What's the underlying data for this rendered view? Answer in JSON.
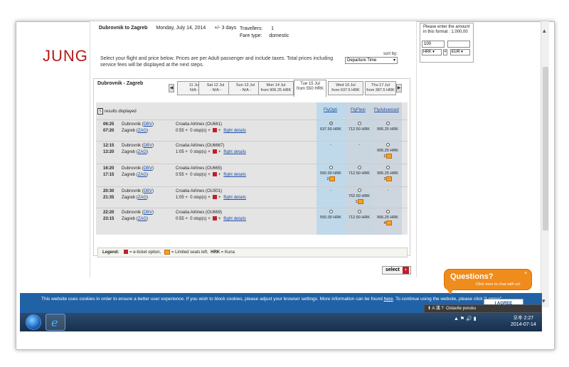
{
  "brand": "JUNG",
  "trip": {
    "route": "Dubrovnik to Zagreb",
    "date": "Monday, July 14, 2014",
    "flex": "+/- 3 days",
    "travellers_label": "Travellers:",
    "travellers_value": "1",
    "fare_label": "Fare type:",
    "fare_value": "domestic"
  },
  "intro": "Select your flight and price below. Prices are per Adult passenger and include taxes. Total prices including service fees will be displayed at the next steps.",
  "sort": {
    "label": "sort by:",
    "value": "Departure Time"
  },
  "route_title": "Dubrovnik - Zagreb",
  "dates": [
    {
      "line1": "11 Jul",
      "line2": "N/A -"
    },
    {
      "line1": "Sat 12 Jul",
      "line2": "- N/A -"
    },
    {
      "line1": "Sun 13 Jul",
      "line2": "- N/A -"
    },
    {
      "line1": "Mon 14 Jul",
      "line2": "from 906.25 HRK"
    },
    {
      "line1": "Tue 15 Jul",
      "line2": "from 550 HRK"
    },
    {
      "line1": "Wed 16 Jul",
      "line2": "from 637.5 HRK"
    },
    {
      "line1": "Thu 17 Jul",
      "line2": "from 387.5 HRK"
    }
  ],
  "results_count": "5",
  "results_label": "results displayed",
  "columns": {
    "opti": "FlyOpti",
    "flexi": "FlyFlexi",
    "advanced": "FlyAdvanced"
  },
  "flights": [
    {
      "dep": "06:25",
      "arr": "07:20",
      "from": "Dubrovnik",
      "from_code": "DBV",
      "to": "Zagreb",
      "to_code": "ZAG",
      "carrier": "Croatia Airlines (OU661)",
      "duration": "0:55",
      "stops": "0 stop(s)",
      "details": "flight details",
      "opti": "637.50 HRK",
      "flexi": "712.50 HRK",
      "advanced": "906.25 HRK",
      "opti_seats": "",
      "flexi_seats": "",
      "advanced_seats": ""
    },
    {
      "dep": "12:15",
      "arr": "13:20",
      "from": "Dubrovnik",
      "from_code": "DBV",
      "to": "Zagreb",
      "to_code": "ZAG",
      "carrier": "Croatia Airlines (OU6667)",
      "duration": "1:05",
      "stops": "0 stop(s)",
      "details": "flight details",
      "opti": "-",
      "flexi": "-",
      "advanced": "906.25 HRK",
      "opti_seats": "",
      "flexi_seats": "",
      "advanced_seats": "2"
    },
    {
      "dep": "16:20",
      "arr": "17:15",
      "from": "Dubrovnik",
      "from_code": "DBV",
      "to": "Zagreb",
      "to_code": "ZAG",
      "carrier": "Croatia Airlines (OU665)",
      "duration": "0:55",
      "stops": "0 stop(s)",
      "details": "flight details",
      "opti": "550.00 HRK",
      "flexi": "712.50 HRK",
      "advanced": "906.25 HRK",
      "opti_seats": "2",
      "flexi_seats": "",
      "advanced_seats": "3"
    },
    {
      "dep": "20:30",
      "arr": "21:35",
      "from": "Dubrovnik",
      "from_code": "DBV",
      "to": "Zagreb",
      "to_code": "ZAG",
      "carrier": "Croatia Airlines (OU301)",
      "duration": "1:05",
      "stops": "0 stop(s)",
      "details": "flight details",
      "opti": "-",
      "flexi": "762.50 HRK",
      "advanced": "-",
      "opti_seats": "",
      "flexi_seats": "1",
      "advanced_seats": ""
    },
    {
      "dep": "22:20",
      "arr": "23:15",
      "from": "Dubrovnik",
      "from_code": "DBV",
      "to": "Zagreb",
      "to_code": "ZAG",
      "carrier": "Croatia Airlines (OU669)",
      "duration": "0:55",
      "stops": "0 stop(s)",
      "details": "flight details",
      "opti": "550.00 HRK",
      "flexi": "712.50 HRK",
      "advanced": "906.25 HRK",
      "opti_seats": "",
      "flexi_seats": "",
      "advanced_seats": "4"
    }
  ],
  "legend": {
    "label": "Legend:",
    "eticket": "= e-ticket option,",
    "seats": "= Limited seats left,",
    "hrk": "HRK",
    "kuna": "= Kuna"
  },
  "select_label": "select",
  "converter": {
    "note": "Please enter the amount in this format : 1.000,00",
    "amount": "100",
    "from": "HRK",
    "eq": "=",
    "to": "EUR"
  },
  "chat": {
    "title": "Questions?",
    "sub": "Click here to chat with us!",
    "close": "×"
  },
  "cookie": {
    "text1": "This website uses cookies in order to ensure a better user experience. If you wish to block cookies, please adjust your browser settings. More information can be found ",
    "link": "here",
    "text2": ". To continue using the website, please click \"I agree\".",
    "agree": "I AGREE"
  },
  "langbar": "Ostavite poruku",
  "clock": {
    "time": "오후 2:27",
    "date": "2014-07-14"
  },
  "colors": {
    "brand": "#b31b1b",
    "accent": "#1a4fa8",
    "cookie_bg": "#2162a6",
    "chat": "#f08c1c"
  }
}
